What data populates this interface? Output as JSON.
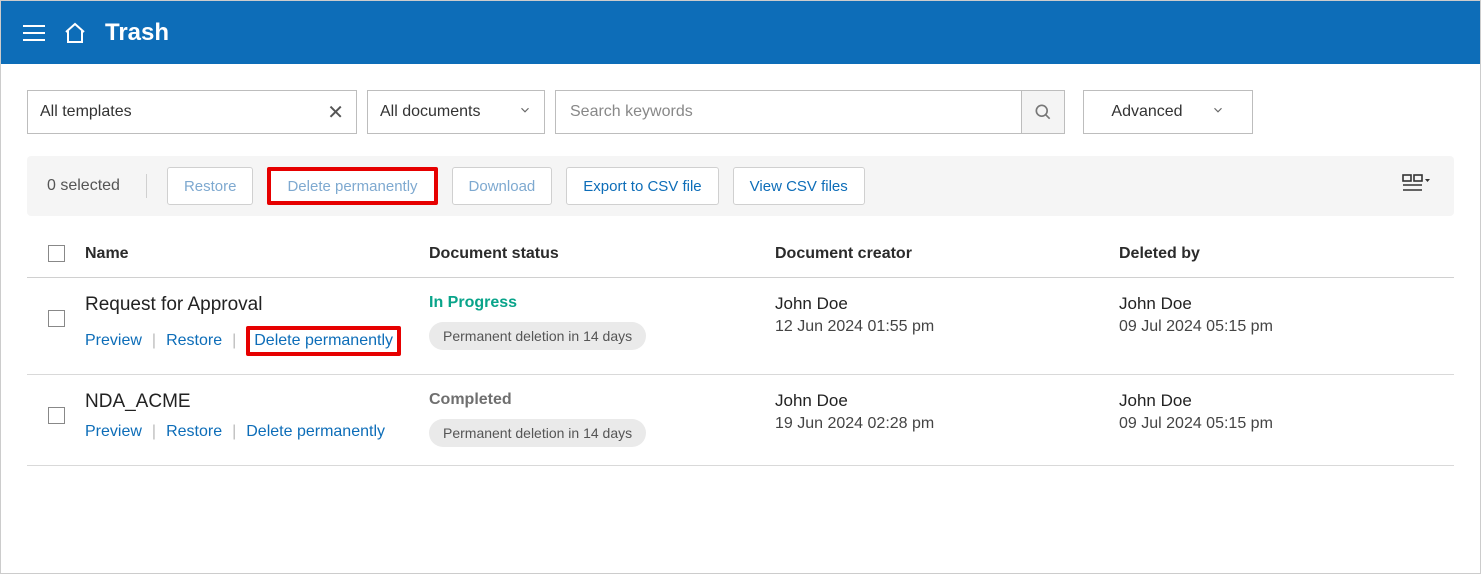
{
  "header": {
    "title": "Trash"
  },
  "filters": {
    "templates_label": "All templates",
    "documents_label": "All documents",
    "search_placeholder": "Search keywords",
    "advanced_label": "Advanced"
  },
  "toolbar": {
    "selected_text": "0 selected",
    "restore": "Restore",
    "delete_permanently": "Delete permanently",
    "download": "Download",
    "export_csv": "Export to CSV file",
    "view_csv": "View CSV files"
  },
  "columns": {
    "name": "Name",
    "status": "Document status",
    "creator": "Document creator",
    "deleted_by": "Deleted by"
  },
  "row_actions": {
    "preview": "Preview",
    "restore": "Restore",
    "delete_permanently": "Delete permanently"
  },
  "rows": [
    {
      "name": "Request for Approval",
      "status_label": "In Progress",
      "status_kind": "inprogress",
      "deletion_note": "Permanent deletion in 14 days",
      "creator_name": "John Doe",
      "creator_date": "12 Jun 2024 01:55 pm",
      "deleted_name": "John Doe",
      "deleted_date": "09 Jul 2024 05:15 pm",
      "highlight_delete": true
    },
    {
      "name": "NDA_ACME",
      "status_label": "Completed",
      "status_kind": "completed",
      "deletion_note": "Permanent deletion in 14 days",
      "creator_name": "John Doe",
      "creator_date": "19 Jun 2024 02:28 pm",
      "deleted_name": "John Doe",
      "deleted_date": "09 Jul 2024 05:15 pm",
      "highlight_delete": false
    }
  ]
}
